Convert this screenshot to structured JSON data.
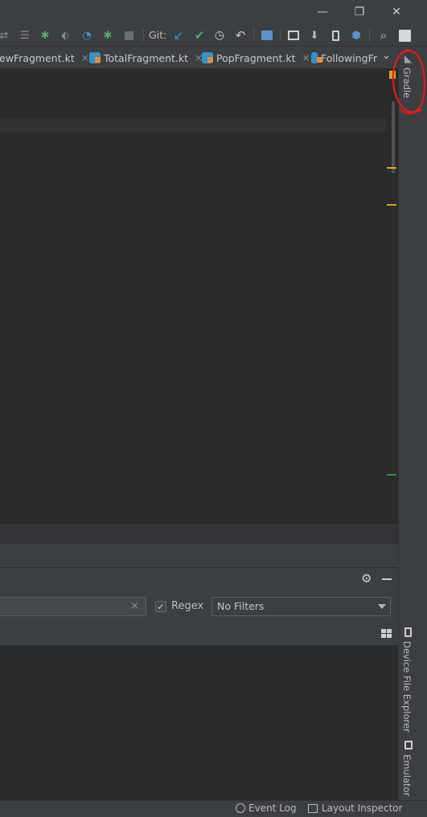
{
  "window": {
    "minimize_label": "—",
    "restore_label": "❐",
    "close_label": "✕"
  },
  "toolbar": {
    "git_label": "Git:",
    "icons": [
      "sync-icon",
      "list-icon",
      "debug-icon",
      "attach-icon",
      "profile-icon",
      "debug-run-icon",
      "stop-icon",
      "git-update-icon",
      "git-commit-icon",
      "git-history-icon",
      "git-rollback-icon",
      "project-structure-icon",
      "avd-icon",
      "sdk-icon",
      "device-manager-icon",
      "package-icon",
      "search-icon",
      "avatar-icon"
    ]
  },
  "tabs": [
    {
      "label": "ewFragment.kt",
      "close": "×",
      "has_icon": false
    },
    {
      "label": "TotalFragment.kt",
      "close": "×",
      "has_icon": true
    },
    {
      "label": "PopFragment.kt",
      "close": "×",
      "has_icon": true
    },
    {
      "label": "FollowingFr",
      "close": "",
      "has_icon": true
    }
  ],
  "tabs_overflow": "⌄",
  "right_stripe": {
    "gradle_label": "Gradle",
    "device_file_explorer_label": "Device File Explorer",
    "emulator_label": "Emulator"
  },
  "panel": {
    "search_clear": "×",
    "regex_label": "Regex",
    "regex_checked": "✓",
    "filters_value": "No Filters"
  },
  "status_bar": {
    "event_log_label": "Event Log",
    "layout_inspector_label": "Layout Inspector"
  },
  "colors": {
    "background": "#2b2b2b",
    "chrome": "#3c3f41",
    "accent_blue": "#3592c4",
    "annotation_red": "#e01a1a",
    "warning_mark": "#d8a62a",
    "ok_mark": "#3e8c3e"
  }
}
